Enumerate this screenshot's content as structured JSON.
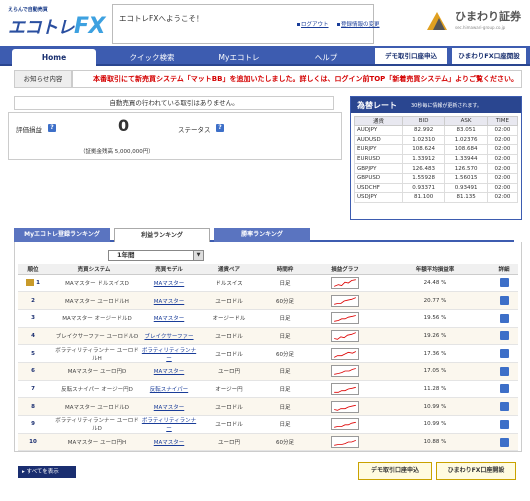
{
  "header": {
    "logo_tag": "えらんで自動売買",
    "logo_name": "エコトレ",
    "logo_fx": "FX",
    "welcome": "エコトレFXへようこそ！",
    "logout": "ログアウト",
    "change_info": "登録情報の変更",
    "broker_name": "ひまわり証券",
    "broker_url": "sec.himawari-group.co.jp"
  },
  "nav": {
    "home": "Home",
    "quick_search": "クイック検索",
    "my_ecotore": "Myエコトレ",
    "help": "ヘルプ",
    "demo_open": "デモ取引口座申込",
    "fx_open": "ひまわりFX口座開設"
  },
  "notice": {
    "label": "お知らせ内容",
    "text": "本番取引にて新売買システム「マットBB」を追加いたしました。詳しくは、ログイン前TOP「新着売買システム」よりご覧ください。"
  },
  "auto": {
    "message": "自動売買の行われている取引はありません。",
    "eval_label": "評価損益",
    "eval_value": "0",
    "status_label": "ステータス",
    "balance": "（証拠金残高 5,000,000円）"
  },
  "rates": {
    "title": "為替レート",
    "note": "30秒毎に情報が更新されます。",
    "headers": [
      "通貨",
      "BID",
      "ASK",
      "TIME"
    ],
    "rows": [
      [
        "AUDJPY",
        "82.992",
        "83.051",
        "02:00"
      ],
      [
        "AUDUSD",
        "1.02310",
        "1.02376",
        "02:00"
      ],
      [
        "EURJPY",
        "108.624",
        "108.684",
        "02:00"
      ],
      [
        "EURUSD",
        "1.33912",
        "1.33944",
        "02:00"
      ],
      [
        "GBPJPY",
        "126.483",
        "126.570",
        "02:00"
      ],
      [
        "GBPUSD",
        "1.55928",
        "1.56015",
        "02:00"
      ],
      [
        "USDCHF",
        "0.93371",
        "0.93491",
        "02:00"
      ],
      [
        "USDJPY",
        "81.100",
        "81.135",
        "02:00"
      ]
    ]
  },
  "ranking": {
    "tabs": [
      "Myエコトレ登録ランキング",
      "利益ランキング",
      "勝率ランキング"
    ],
    "period": "1年間",
    "headers": [
      "順位",
      "売買システム",
      "売買モデル",
      "通貨ペア",
      "時間枠",
      "損益グラフ",
      "年額平均損益率",
      "詳細"
    ],
    "rows": [
      [
        "1",
        "MAマスター ドルスイスD",
        "MAマスター",
        "ドルスイス",
        "日足",
        "",
        "24.48 %"
      ],
      [
        "2",
        "MAマスター ユーロドルH",
        "MAマスター",
        "ユーロドル",
        "60分足",
        "",
        "20.77 %"
      ],
      [
        "3",
        "MAマスター オージードルD",
        "MAマスター",
        "オージードル",
        "日足",
        "",
        "19.56 %"
      ],
      [
        "4",
        "ブレイクサーファー ユーロドルD",
        "ブレイクサーファー",
        "ユーロドル",
        "日足",
        "",
        "19.26 %"
      ],
      [
        "5",
        "ボラティリティランナー ユーロドルH",
        "ボラティリティランナー",
        "ユーロドル",
        "60分足",
        "",
        "17.36 %"
      ],
      [
        "6",
        "MAマスター ユーロ円D",
        "MAマスター",
        "ユーロ円",
        "日足",
        "",
        "17.05 %"
      ],
      [
        "7",
        "反転スナイパー オージー円D",
        "反転スナイパー",
        "オージー円",
        "日足",
        "",
        "11.28 %"
      ],
      [
        "8",
        "MAマスター ユーロドルD",
        "MAマスター",
        "ユーロドル",
        "日足",
        "",
        "10.99 %"
      ],
      [
        "9",
        "ボラティリティランナー ユーロドルD",
        "ボラティリティランナー",
        "ユーロドル",
        "日足",
        "",
        "10.99 %"
      ],
      [
        "10",
        "MAマスター ユーロ円H",
        "MAマスター",
        "ユーロ円",
        "60分足",
        "",
        "10.88 %"
      ]
    ]
  },
  "footer": {
    "show_all": "すべてを表示",
    "demo_open": "デモ取引口座申込",
    "fx_open": "ひまわりFX口座開設"
  }
}
